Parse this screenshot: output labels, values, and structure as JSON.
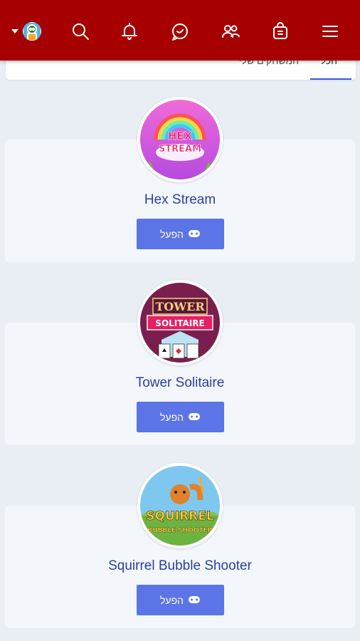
{
  "header": {
    "background_color": "#a60000",
    "icons": [
      "avatar",
      "search-icon",
      "bell-icon",
      "chat-icon",
      "users-icon",
      "shop-icon",
      "menu-icon"
    ]
  },
  "tabs": {
    "active_label": "הכל",
    "other_label": "המשחקים שלי"
  },
  "games": [
    {
      "title": "Hex Stream",
      "thumb_text": "HEX STREAM",
      "play_label": "הפעל"
    },
    {
      "title": "Tower Solitaire",
      "thumb_text_1": "TOWER",
      "thumb_text_2": "SOLITAIRE",
      "play_label": "הפעל"
    },
    {
      "title": "Squirrel Bubble Shooter",
      "thumb_text_1": "SQUIRREL",
      "thumb_text_2": "BUBBLE SHOOTER",
      "play_label": "הפעל"
    }
  ],
  "colors": {
    "play_button": "#5b74e6",
    "title_text": "#2b3f99",
    "card_bg": "#f3f7fc",
    "page_bg": "#e9eef5"
  }
}
